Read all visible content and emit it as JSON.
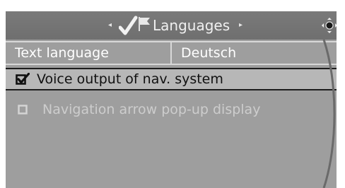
{
  "header": {
    "title": "Languages",
    "left_arrow": "◂",
    "right_arrow": "▸",
    "title_icon": "check-flag-icon",
    "controller_icon": "controller-icon"
  },
  "settings": {
    "label": "Text language",
    "value": "Deutsch"
  },
  "menu": {
    "items": [
      {
        "label": "Voice output of nav. system",
        "checked": true,
        "selected": true
      },
      {
        "label": "Navigation arrow pop-up display",
        "checked": false,
        "enabled": false
      }
    ]
  },
  "colors": {
    "background": "#9e9e9e",
    "titlebar": "#737373",
    "highlight": "#b7b7b7",
    "selected_text": "#111111",
    "disabled_text": "#cdcdcd"
  }
}
